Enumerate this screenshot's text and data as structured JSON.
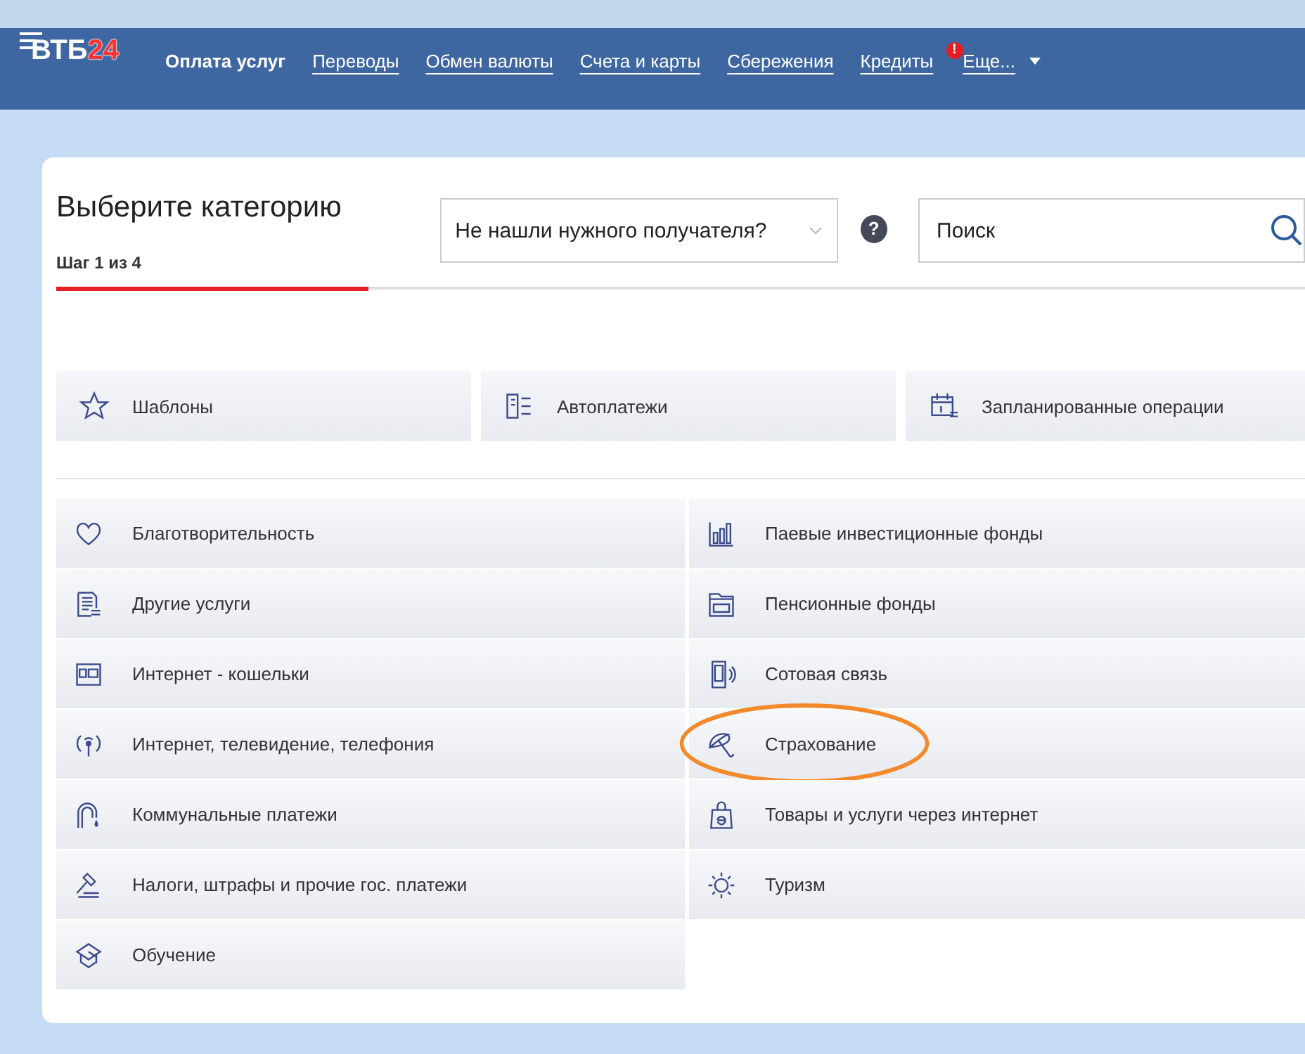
{
  "logo": {
    "name": "ВТБ",
    "number": "24"
  },
  "nav": [
    {
      "label": "Оплата услуг",
      "selected": true
    },
    {
      "label": "Переводы",
      "selected": false
    },
    {
      "label": "Обмен валюты",
      "selected": false
    },
    {
      "label": "Счета и карты",
      "selected": false
    },
    {
      "label": "Сбережения",
      "selected": false
    },
    {
      "label": "Кредиты",
      "selected": false
    },
    {
      "label": "Еще...",
      "selected": false,
      "badge": "!",
      "has_menu": true
    }
  ],
  "page": {
    "title": "Выберите категорию",
    "step": "Шаг 1 из 4",
    "step_bar": {
      "level": 0.25
    }
  },
  "recipient_dropdown": {
    "value": "Не нашли нужного получателя?"
  },
  "help": {
    "label": "?"
  },
  "search": {
    "placeholder": "Поиск"
  },
  "quick_actions": [
    {
      "label": "Шаблоны"
    },
    {
      "label": "Автоплатежи"
    },
    {
      "label": "Запланированные операции"
    }
  ],
  "categories_left": [
    {
      "label": "Благотворительность",
      "highlighted": false
    },
    {
      "label": "Другие услуги",
      "highlighted": false
    },
    {
      "label": "Интернет - кошельки",
      "highlighted": false
    },
    {
      "label": "Интернет, телевидение, телефония",
      "highlighted": false
    },
    {
      "label": "Коммунальные платежи",
      "highlighted": false
    },
    {
      "label": "Налоги, штрафы и прочие гос. платежи",
      "highlighted": false
    },
    {
      "label": "Обучение",
      "highlighted": false
    }
  ],
  "categories_right": [
    {
      "label": "Паевые инвестиционные фонды",
      "highlighted": false
    },
    {
      "label": "Пенсионные фонды",
      "highlighted": false
    },
    {
      "label": "Сотовая связь",
      "highlighted": false
    },
    {
      "label": "Страхование",
      "highlighted": true
    },
    {
      "label": "Товары и услуги через интернет",
      "highlighted": false
    },
    {
      "label": "Туризм",
      "highlighted": false
    }
  ]
}
